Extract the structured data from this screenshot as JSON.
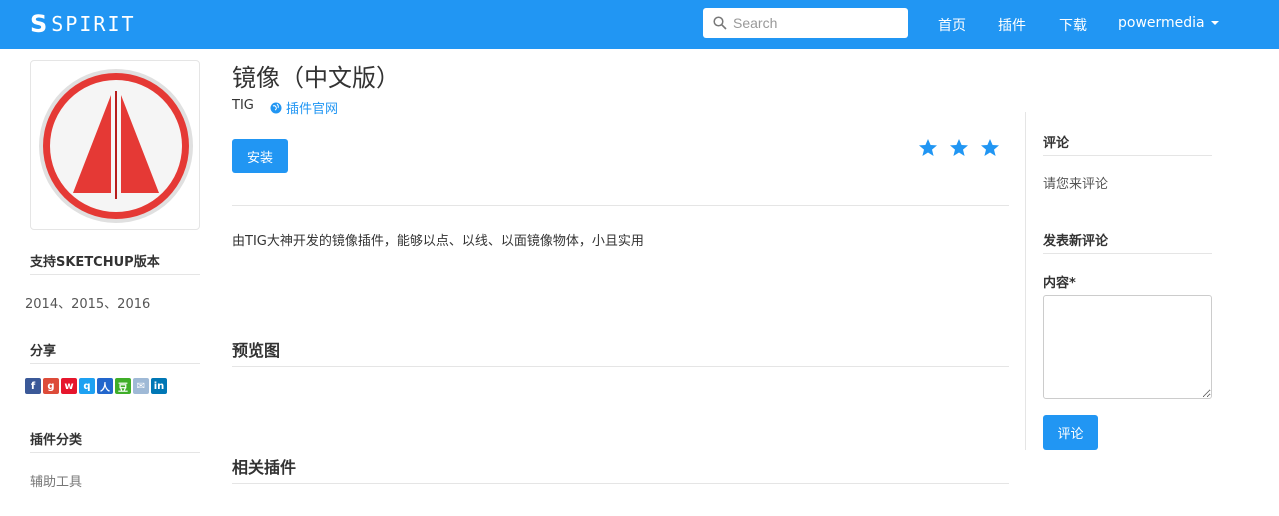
{
  "navbar": {
    "brand": "SPIRIT",
    "search_placeholder": "Search",
    "links": [
      "首页",
      "插件",
      "下载"
    ],
    "user": "powermedia",
    "accent_color": "#2196f3"
  },
  "sidebar": {
    "logo_icon": "mirror-triangles-icon",
    "versions_heading": "支持SKETCHUP版本",
    "versions": "2014、2015、2016",
    "share_heading": "分享",
    "share_icons": [
      "facebook-icon",
      "google-plus-icon",
      "weibo-icon",
      "qzone-icon",
      "renren-icon",
      "douban-icon",
      "email-icon",
      "linkedin-icon"
    ],
    "category_heading": "插件分类",
    "category": "辅助工具"
  },
  "main": {
    "title": "镜像（中文版）",
    "author": "TIG",
    "website_link": "插件官网",
    "install_button": "安装",
    "rating_stars": 3,
    "description": "由TIG大神开发的镜像插件，能够以点、以线、以面镜像物体，小且实用",
    "preview_heading": "预览图",
    "related_heading": "相关插件"
  },
  "comments": {
    "heading": "评论",
    "empty_text": "请您来评论",
    "new_heading": "发表新评论",
    "content_label": "内容*",
    "content_value": "",
    "submit_button": "评论"
  }
}
